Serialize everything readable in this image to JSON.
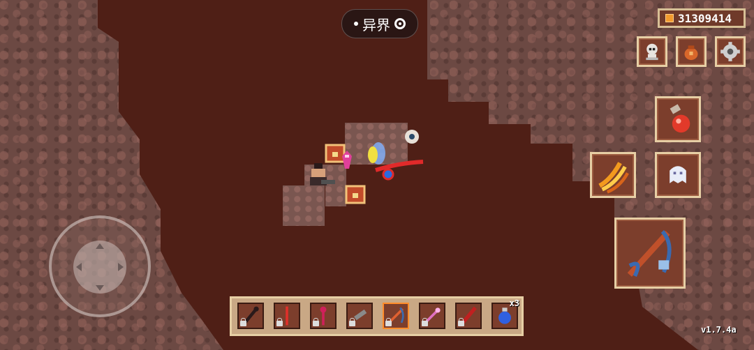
{
  "hud": {
    "title": "异界",
    "currency_amount": "31309414",
    "version": "v1.7.4a"
  },
  "top_buttons": [
    {
      "name": "skull-menu-button",
      "icon": "skull-icon"
    },
    {
      "name": "bag-menu-button",
      "icon": "loot-bag-icon"
    },
    {
      "name": "settings-button",
      "icon": "gear-icon"
    }
  ],
  "action_buttons": [
    {
      "name": "potion-button",
      "icon": "health-potion-icon"
    },
    {
      "name": "claw-skill-button",
      "icon": "claw-slash-icon"
    },
    {
      "name": "ghost-skill-button",
      "icon": "ghost-icon"
    },
    {
      "name": "attack-button",
      "icon": "crossbow-icon"
    }
  ],
  "hotbar": [
    {
      "icon": "dark-staff-icon",
      "locked": true,
      "color": "#2a1a1a"
    },
    {
      "icon": "red-sword-icon",
      "locked": true,
      "color": "#e0302a"
    },
    {
      "icon": "crimson-scepter-icon",
      "locked": true,
      "color": "#d0205a"
    },
    {
      "icon": "pistol-icon",
      "locked": true,
      "color": "#8a8a8a"
    },
    {
      "icon": "crossbow-icon",
      "locked": true,
      "color": "#e06030",
      "selected": true
    },
    {
      "icon": "pink-wand-icon",
      "locked": true,
      "color": "#e070c0"
    },
    {
      "icon": "red-blade-icon",
      "locked": true,
      "color": "#c02020"
    },
    {
      "icon": "blue-potion-icon",
      "locked": false,
      "color": "#3060e0",
      "count": "x3"
    }
  ],
  "colors": {
    "cave_floor": "#4f1f16",
    "rock": "#6c4943",
    "slot_frame": "#e7cfa5",
    "slot_fill": "#7c3e2c"
  }
}
